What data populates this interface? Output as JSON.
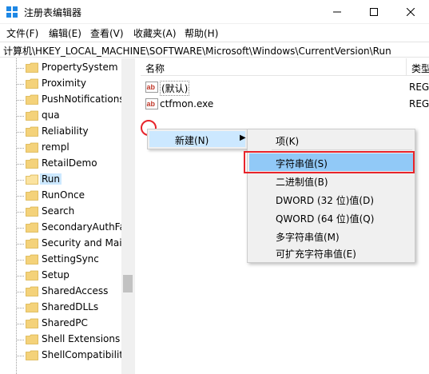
{
  "window": {
    "title": "注册表编辑器",
    "controls": {
      "minimize": "minimize-icon",
      "maximize": "maximize-icon",
      "close": "close-icon"
    }
  },
  "menubar": {
    "items": [
      {
        "label": "文件(F)"
      },
      {
        "label": "编辑(E)"
      },
      {
        "label": "查看(V)"
      },
      {
        "label": "收藏夹(A)"
      },
      {
        "label": "帮助(H)"
      }
    ]
  },
  "address": {
    "path": "计算机\\HKEY_LOCAL_MACHINE\\SOFTWARE\\Microsoft\\Windows\\CurrentVersion\\Run"
  },
  "tree": {
    "items": [
      {
        "label": "PropertySystem"
      },
      {
        "label": "Proximity"
      },
      {
        "label": "PushNotifications"
      },
      {
        "label": "qua"
      },
      {
        "label": "Reliability"
      },
      {
        "label": "rempl"
      },
      {
        "label": "RetailDemo"
      },
      {
        "label": "Run",
        "selected": true
      },
      {
        "label": "RunOnce"
      },
      {
        "label": "Search"
      },
      {
        "label": "SecondaryAuthFa"
      },
      {
        "label": "Security and Mair"
      },
      {
        "label": "SettingSync"
      },
      {
        "label": "Setup"
      },
      {
        "label": "SharedAccess"
      },
      {
        "label": "SharedDLLs"
      },
      {
        "label": "SharedPC"
      },
      {
        "label": "Shell Extensions"
      },
      {
        "label": "ShellCompatibility"
      }
    ]
  },
  "list": {
    "columns": [
      {
        "label": "名称"
      },
      {
        "label": "类型"
      }
    ],
    "rows": [
      {
        "name": "(默认)",
        "type": "REG"
      },
      {
        "name": "ctfmon.exe",
        "type": "REG"
      }
    ]
  },
  "context_menu": {
    "new_item": {
      "label": "新建(N)",
      "arrow": "▶"
    },
    "submenu": [
      {
        "label": "项(K)"
      },
      {
        "label": "字符串值(S)",
        "highlighted": true
      },
      {
        "label": "二进制值(B)"
      },
      {
        "label": "DWORD (32 位)值(D)"
      },
      {
        "label": "QWORD (64 位)值(Q)"
      },
      {
        "label": "多字符串值(M)"
      },
      {
        "label": "可扩充字符串值(E)"
      }
    ]
  },
  "colors": {
    "selection": "#cce8ff",
    "menu_highlight": "#91c9f7",
    "annotation_red": "#e8242b",
    "folder": "#f4d27a"
  }
}
